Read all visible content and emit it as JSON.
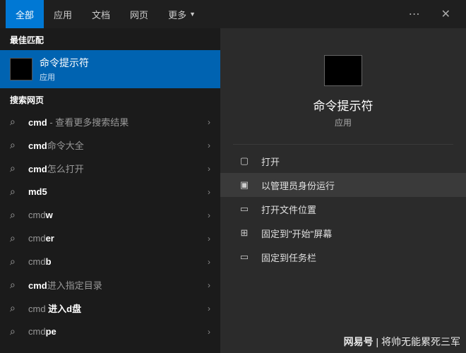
{
  "tabs": {
    "all": "全部",
    "apps": "应用",
    "docs": "文档",
    "web": "网页",
    "more": "更多"
  },
  "sections": {
    "best_match": "最佳匹配",
    "search_web": "搜索网页"
  },
  "best_match": {
    "title": "命令提示符",
    "subtitle": "应用"
  },
  "web_items": [
    {
      "pre": "",
      "bold": "cmd",
      "post": " - 查看更多搜索结果"
    },
    {
      "pre": "",
      "bold": "cmd",
      "post": "命令大全"
    },
    {
      "pre": "",
      "bold": "cmd",
      "post": "怎么打开"
    },
    {
      "pre": "",
      "bold": "md5",
      "post": ""
    },
    {
      "pre": "cmd",
      "bold": "w",
      "post": ""
    },
    {
      "pre": "cmd",
      "bold": "er",
      "post": ""
    },
    {
      "pre": "cmd",
      "bold": "b",
      "post": ""
    },
    {
      "pre": "",
      "bold": "cmd",
      "post": "进入指定目录"
    },
    {
      "pre": "cmd ",
      "bold": "进入d盘",
      "post": ""
    },
    {
      "pre": "cmd",
      "bold": "pe",
      "post": ""
    }
  ],
  "preview": {
    "title": "命令提示符",
    "subtitle": "应用"
  },
  "actions": {
    "open": "打开",
    "admin": "以管理员身份运行",
    "location": "打开文件位置",
    "pin_start": "固定到\"开始\"屏幕",
    "pin_taskbar": "固定到任务栏"
  },
  "watermark": {
    "logo": "网易号",
    "sep": " | ",
    "author": "将帅无能累死三军"
  }
}
